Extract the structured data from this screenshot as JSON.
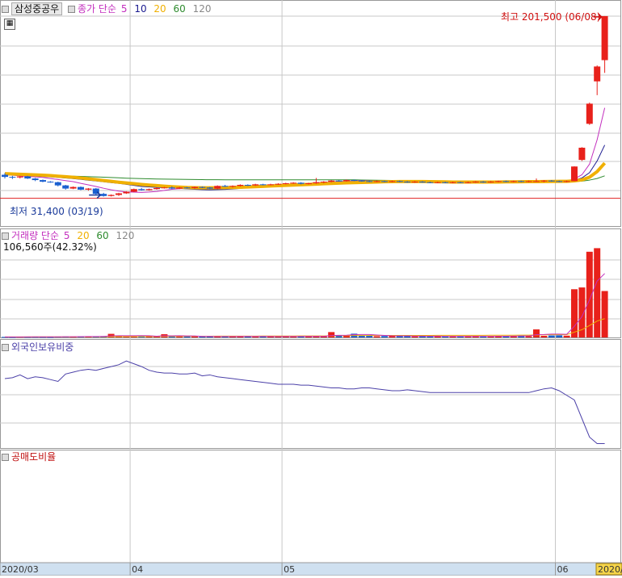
{
  "chart_data": [
    {
      "type": "candlestick",
      "title": "삼성중공우",
      "legend": {
        "prefix": "종가 단순",
        "periods": [
          "5",
          "10",
          "20",
          "60",
          "120"
        ]
      },
      "ylim": [
        25000,
        206000
      ],
      "high_annotation": {
        "label": "최고 201,500 (06/08)",
        "value": 201500
      },
      "low_annotation": {
        "label": "최저 31,400 (03/19)",
        "value": 31400
      },
      "candles": [
        [
          52000,
          53500,
          48500,
          50000
        ],
        [
          50000,
          51000,
          48000,
          49500
        ],
        [
          49500,
          51000,
          48500,
          50500
        ],
        [
          50500,
          51000,
          48000,
          48500
        ],
        [
          48500,
          49000,
          46000,
          47000
        ],
        [
          47000,
          47500,
          45000,
          45500
        ],
        [
          45500,
          46000,
          44500,
          45000
        ],
        [
          45000,
          45500,
          41000,
          42000
        ],
        [
          42000,
          42500,
          38000,
          39000
        ],
        [
          39000,
          41000,
          38500,
          40500
        ],
        [
          40500,
          41000,
          37500,
          38000
        ],
        [
          38000,
          39500,
          37000,
          39000
        ],
        [
          39000,
          39500,
          33000,
          34000
        ],
        [
          34000,
          35000,
          31400,
          32000
        ],
        [
          32000,
          33500,
          31500,
          33000
        ],
        [
          33000,
          35000,
          32000,
          34500
        ],
        [
          34500,
          36500,
          34000,
          36000
        ],
        [
          36000,
          39000,
          35500,
          38500
        ],
        [
          38500,
          39500,
          37000,
          37500
        ],
        [
          37500,
          39000,
          37000,
          38500
        ],
        [
          38500,
          40000,
          38000,
          39500
        ],
        [
          39500,
          40500,
          39000,
          40000
        ],
        [
          40000,
          41000,
          38500,
          39000
        ],
        [
          39000,
          40500,
          38500,
          40000
        ],
        [
          40000,
          40500,
          39000,
          39500
        ],
        [
          39500,
          41000,
          39000,
          40500
        ],
        [
          40500,
          41000,
          39500,
          40000
        ],
        [
          40000,
          40500,
          38500,
          39000
        ],
        [
          39000,
          42000,
          38500,
          41500
        ],
        [
          41500,
          42500,
          40500,
          41000
        ],
        [
          41000,
          42000,
          40000,
          41500
        ],
        [
          41500,
          43000,
          41000,
          42500
        ],
        [
          42500,
          43000,
          41500,
          42000
        ],
        [
          42000,
          43500,
          41500,
          43000
        ],
        [
          43000,
          43500,
          42000,
          42500
        ],
        [
          42500,
          43500,
          42000,
          43000
        ],
        [
          43000,
          44000,
          42500,
          43500
        ],
        [
          43500,
          44500,
          43000,
          44000
        ],
        [
          44000,
          45000,
          43500,
          44500
        ],
        [
          44500,
          45000,
          43000,
          43500
        ],
        [
          43500,
          44500,
          43000,
          44000
        ],
        [
          44000,
          49000,
          43500,
          45000
        ],
        [
          45000,
          46000,
          44000,
          45500
        ],
        [
          45500,
          47000,
          45000,
          46500
        ],
        [
          46500,
          47000,
          45500,
          46000
        ],
        [
          46000,
          47500,
          45500,
          47000
        ],
        [
          47000,
          47500,
          46000,
          46500
        ],
        [
          46500,
          47000,
          45500,
          46000
        ],
        [
          46000,
          46500,
          45000,
          45500
        ],
        [
          45500,
          46500,
          45000,
          46000
        ],
        [
          46000,
          46500,
          45000,
          45500
        ],
        [
          45500,
          46500,
          45000,
          46000
        ],
        [
          46000,
          46500,
          45000,
          45500
        ],
        [
          45500,
          46000,
          44500,
          45000
        ],
        [
          45000,
          46000,
          44500,
          45500
        ],
        [
          45500,
          46000,
          44500,
          45000
        ],
        [
          45000,
          45500,
          44000,
          44500
        ],
        [
          44500,
          45500,
          44000,
          45000
        ],
        [
          45000,
          45500,
          44000,
          44500
        ],
        [
          44500,
          45500,
          44000,
          45000
        ],
        [
          45000,
          45500,
          44000,
          44500
        ],
        [
          44500,
          45500,
          44000,
          45000
        ],
        [
          45000,
          46000,
          44500,
          45500
        ],
        [
          45500,
          46000,
          44500,
          45000
        ],
        [
          45000,
          46000,
          44500,
          45500
        ],
        [
          45500,
          46500,
          45000,
          46000
        ],
        [
          46000,
          46500,
          45000,
          45500
        ],
        [
          45500,
          46500,
          45000,
          46000
        ],
        [
          46000,
          46500,
          45000,
          45500
        ],
        [
          45500,
          46500,
          45000,
          46000
        ],
        [
          46000,
          48500,
          45500,
          46000
        ],
        [
          46000,
          47000,
          45000,
          46500
        ],
        [
          46500,
          47000,
          45500,
          46000
        ],
        [
          46000,
          46500,
          45000,
          45500
        ],
        [
          45500,
          46500,
          45000,
          46000
        ],
        [
          46000,
          60000,
          46000,
          59800
        ],
        [
          66000,
          78000,
          65000,
          77500
        ],
        [
          100000,
          120000,
          99000,
          119000
        ],
        [
          140000,
          155000,
          127000,
          154000
        ],
        [
          160000,
          201500,
          148000,
          201500
        ]
      ],
      "ma": {
        "5": [
          52000,
          51500,
          51000,
          50500,
          50000,
          49500,
          48500,
          47500,
          46500,
          45500,
          43900,
          42500,
          41000,
          39300,
          37800,
          36600,
          35800,
          35600,
          35400,
          35700,
          36300,
          37300,
          38300,
          38900,
          39300,
          39500,
          39800,
          39800,
          39800,
          40000,
          40200,
          40700,
          41300,
          41800,
          42200,
          42400,
          42700,
          43000,
          43500,
          43700,
          43900,
          44500,
          44800,
          45300,
          45600,
          46000,
          46300,
          46400,
          46300,
          46200,
          45900,
          45900,
          45800,
          45700,
          45500,
          45300,
          45100,
          44900,
          44800,
          44800,
          44800,
          44800,
          44900,
          45000,
          45200,
          45400,
          45500,
          45600,
          45700,
          45800,
          45800,
          45900,
          46000,
          46000,
          46000,
          48000,
          52000,
          62000,
          85000,
          115000
        ],
        "10": [
          52000,
          51700,
          51400,
          51100,
          50800,
          50400,
          50000,
          49500,
          49000,
          48400,
          47700,
          46900,
          46200,
          45400,
          44600,
          43900,
          43000,
          42000,
          41000,
          40600,
          40100,
          39900,
          39600,
          39200,
          38700,
          38300,
          38000,
          37800,
          38000,
          38200,
          38600,
          39200,
          39800,
          40300,
          40800,
          41200,
          41600,
          42000,
          42300,
          42700,
          43000,
          43400,
          43800,
          44200,
          44600,
          45000,
          45300,
          45500,
          45700,
          45800,
          45900,
          46000,
          46000,
          46000,
          45900,
          45800,
          45600,
          45400,
          45200,
          45000,
          44900,
          44900,
          44900,
          44900,
          44900,
          45000,
          45100,
          45200,
          45300,
          45400,
          45500,
          45600,
          45700,
          45800,
          45900,
          47000,
          49000,
          54000,
          65000,
          80000
        ],
        "20": [
          53000,
          52800,
          52500,
          52200,
          51900,
          51600,
          51200,
          50700,
          50200,
          49600,
          49000,
          48200,
          47400,
          46600,
          45800,
          45000,
          44300,
          43600,
          42900,
          42300,
          41800,
          41300,
          40800,
          40400,
          40000,
          39800,
          39700,
          39700,
          39800,
          39900,
          40000,
          40200,
          40500,
          40800,
          41100,
          41400,
          41700,
          42000,
          42300,
          42600,
          42900,
          43200,
          43500,
          43800,
          44100,
          44400,
          44600,
          44800,
          45000,
          45200,
          45400,
          45500,
          45600,
          45600,
          45600,
          45600,
          45500,
          45400,
          45300,
          45200,
          45200,
          45200,
          45200,
          45200,
          45200,
          45200,
          45300,
          45300,
          45400,
          45500,
          45500,
          45600,
          45700,
          45800,
          45800,
          46300,
          47200,
          49700,
          55000,
          63000
        ],
        "60": [
          52000,
          51900,
          51800,
          51700,
          51600,
          51500,
          51300,
          51100,
          50900,
          50700,
          50500,
          50200,
          50000,
          49700,
          49400,
          49100,
          48800,
          48600,
          48400,
          48200,
          48000,
          47900,
          47800,
          47700,
          47600,
          47500,
          47400,
          47300,
          47300,
          47200,
          47200,
          47200,
          47200,
          47200,
          47200,
          47200,
          47200,
          47200,
          47200,
          47200,
          47200,
          47200,
          47200,
          47200,
          47200,
          47200,
          47200,
          47100,
          47000,
          46900,
          46800,
          46700,
          46600,
          46500,
          46400,
          46300,
          46200,
          46100,
          46000,
          45900,
          45800,
          45700,
          45600,
          45500,
          45400,
          45300,
          45300,
          45200,
          45200,
          45200,
          45200,
          45200,
          45200,
          45200,
          45200,
          45500,
          46000,
          47000,
          48500,
          51000
        ]
      },
      "volume": {
        "legend": {
          "prefix": "거래량 단순",
          "periods": [
            "5",
            "20",
            "60",
            "120"
          ]
        },
        "title": "106,560주(42.32%)",
        "max": 52000,
        "values": [
          300,
          250,
          400,
          300,
          350,
          300,
          250,
          450,
          500,
          400,
          600,
          500,
          450,
          700,
          2000,
          900,
          600,
          700,
          800,
          900,
          500,
          1800,
          600,
          700,
          500,
          600,
          400,
          500,
          600,
          500,
          600,
          700,
          500,
          400,
          500,
          600,
          500,
          700,
          400,
          600,
          800,
          500,
          600,
          3000,
          900,
          1200,
          2100,
          1100,
          900,
          700,
          800,
          900,
          700,
          1000,
          600,
          700,
          500,
          800,
          600,
          500,
          600,
          700,
          800,
          500,
          600,
          700,
          900,
          800,
          1000,
          700,
          4500,
          900,
          1100,
          1200,
          1000,
          27000,
          28000,
          48000,
          50000,
          26000
        ],
        "ma5": [
          300,
          300,
          300,
          320,
          340,
          330,
          320,
          350,
          370,
          380,
          440,
          490,
          530,
          550,
          850,
          950,
          950,
          960,
          1000,
          980,
          700,
          950,
          920,
          960,
          820,
          840,
          560,
          560,
          520,
          520,
          520,
          560,
          560,
          540,
          540,
          540,
          500,
          540,
          540,
          560,
          600,
          620,
          600,
          1100,
          1160,
          1240,
          1560,
          1660,
          1640,
          1380,
          1120,
          880,
          840,
          840,
          740,
          740,
          680,
          720,
          640,
          620,
          620,
          640,
          640,
          620,
          640,
          660,
          700,
          760,
          800,
          820,
          1580,
          1660,
          1840,
          1880,
          1740,
          6240,
          11660,
          21040,
          31600,
          35800
        ],
        "ma20": [
          300,
          300,
          310,
          310,
          320,
          320,
          320,
          330,
          340,
          350,
          370,
          380,
          390,
          410,
          460,
          480,
          490,
          510,
          530,
          550,
          560,
          630,
          640,
          650,
          660,
          680,
          690,
          700,
          720,
          720,
          730,
          740,
          750,
          760,
          770,
          780,
          790,
          800,
          810,
          820,
          830,
          840,
          850,
          960,
          990,
          1010,
          1060,
          1080,
          1100,
          1110,
          1120,
          1130,
          1130,
          1140,
          1140,
          1150,
          1150,
          1160,
          1160,
          1170,
          1180,
          1190,
          1200,
          1210,
          1220,
          1230,
          1250,
          1270,
          1290,
          1300,
          1420,
          1460,
          1500,
          1540,
          1580,
          2960,
          4350,
          6720,
          9190,
          10500
        ]
      },
      "foreign": {
        "title": "외국인보유비중",
        "ylim": [
          0,
          100
        ],
        "values": [
          73,
          74,
          77,
          73,
          75,
          74,
          72,
          70,
          78,
          80,
          82,
          83,
          82,
          84,
          86,
          88,
          92,
          89,
          86,
          82,
          80,
          79,
          79,
          78,
          78,
          79,
          76,
          77,
          75,
          74,
          73,
          72,
          71,
          70,
          69,
          68,
          67,
          67,
          67,
          66,
          66,
          65,
          64,
          63,
          63,
          62,
          62,
          63,
          63,
          62,
          61,
          60,
          60,
          61,
          60,
          59,
          58,
          58,
          58,
          58,
          58,
          58,
          58,
          58,
          58,
          58,
          58,
          58,
          58,
          58,
          60,
          62,
          63,
          60,
          55,
          50,
          30,
          10,
          3,
          3
        ]
      },
      "short": {
        "title": "공매도비율"
      },
      "x_ticks": [
        {
          "label": "2020/03",
          "index": 0
        },
        {
          "label": "04",
          "index": 17
        },
        {
          "label": "05",
          "index": 37
        },
        {
          "label": "06",
          "index": 73
        },
        {
          "label": "2020/",
          "index": 79
        }
      ]
    }
  ],
  "colors": {
    "up": "#e8211b",
    "down": "#1a5fd0",
    "ma5": "#c32fbe",
    "ma10": "#1b1b90",
    "ma20": "#f0b000",
    "ma60": "#2e8b2e",
    "grid": "#c8c8c8",
    "base_line": "#e02020",
    "annotation": "#d01010",
    "low_annotation": "#1a3a9a",
    "axis_bg": "#cfe0f0",
    "foreign": "#4b40a8",
    "title_bg": "#e8e8e8"
  },
  "icons": {
    "grid_button": "table-grid-icon"
  }
}
